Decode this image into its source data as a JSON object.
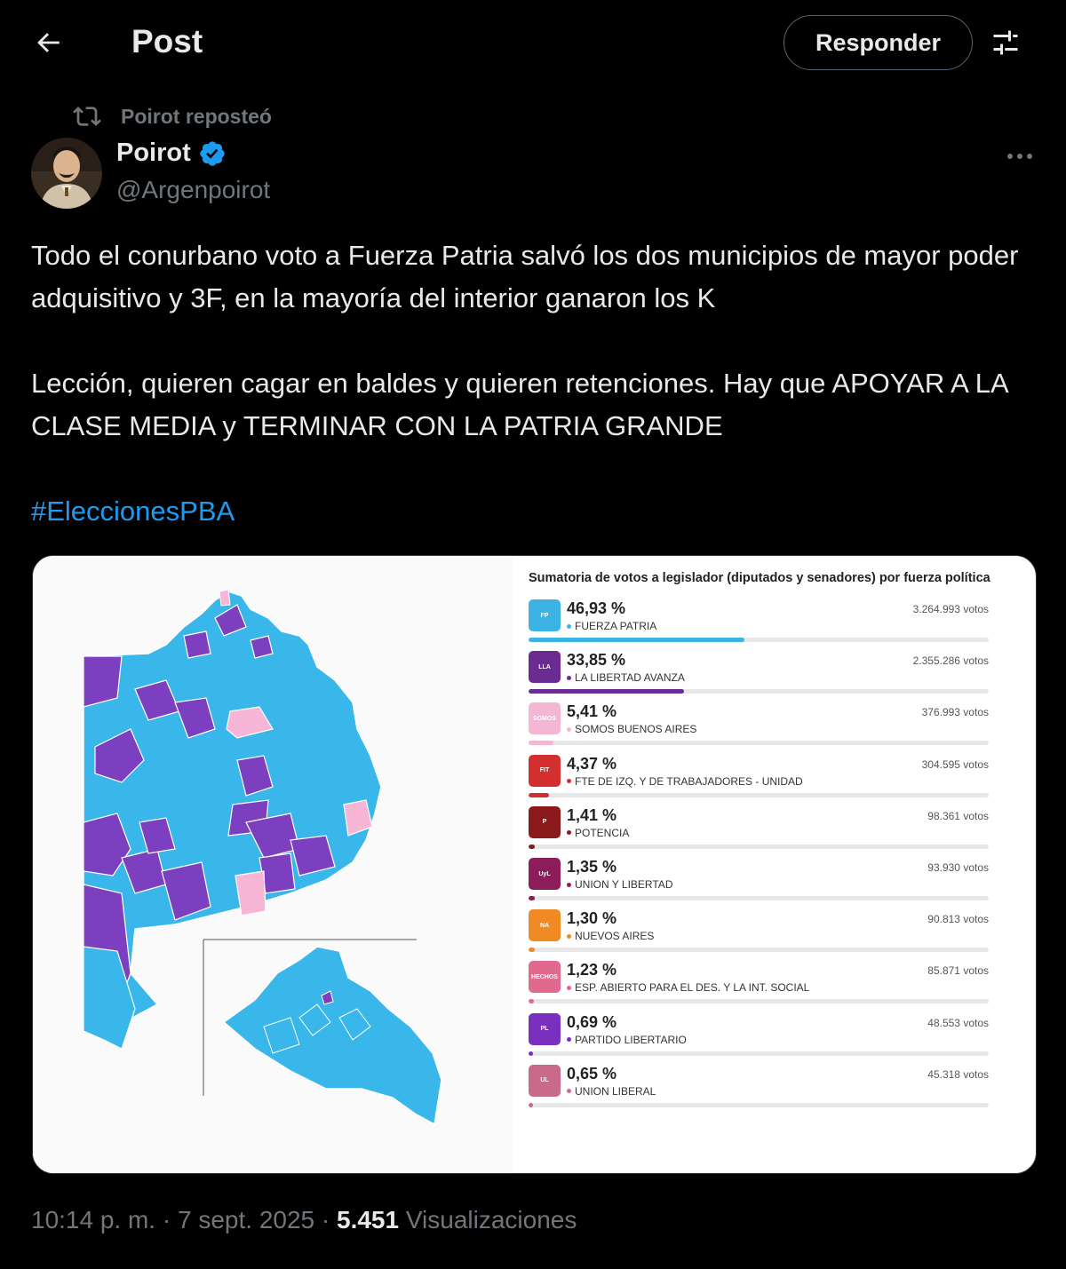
{
  "header": {
    "title": "Post",
    "reply_label": "Responder"
  },
  "repost": {
    "text": "Poirot reposteó"
  },
  "author": {
    "name": "Poirot",
    "handle": "@Argenpoirot"
  },
  "tweet": {
    "paragraph1": "Todo el conurbano voto a Fuerza Patria salvó los dos municipios de mayor poder adquisitivo y 3F, en la mayoría del interior ganaron los K",
    "paragraph2": "Lección, quieren cagar en baldes y quieren retenciones. Hay que APOYAR A LA CLASE MEDIA y TERMINAR CON LA PATRIA GRANDE",
    "hashtag": "#EleccionesPBA"
  },
  "chart_data": {
    "type": "bar",
    "title": "Sumatoria de votos a legislador (diputados y senadores) por fuerza política",
    "parties": [
      {
        "pct": "46,93 %",
        "name": "FUERZA PATRIA",
        "votes": "3.264.993 votos",
        "value": 46.93,
        "color": "#3bb4e5",
        "logo": "FP"
      },
      {
        "pct": "33,85 %",
        "name": "LA LIBERTAD AVANZA",
        "votes": "2.355.286 votos",
        "value": 33.85,
        "color": "#6a2c91",
        "logo": "LLA"
      },
      {
        "pct": "5,41 %",
        "name": "SOMOS BUENOS AIRES",
        "votes": "376.993 votos",
        "value": 5.41,
        "color": "#f4b6d2",
        "logo": "SOMOS"
      },
      {
        "pct": "4,37 %",
        "name": "FTE DE IZQ. Y DE TRABAJADORES - UNIDAD",
        "votes": "304.595 votos",
        "value": 4.37,
        "color": "#d32f2f",
        "logo": "FIT"
      },
      {
        "pct": "1,41 %",
        "name": "POTENCIA",
        "votes": "98.361 votos",
        "value": 1.41,
        "color": "#8b1a1a",
        "logo": "P"
      },
      {
        "pct": "1,35 %",
        "name": "UNION Y LIBERTAD",
        "votes": "93.930 votos",
        "value": 1.35,
        "color": "#8c1d5a",
        "logo": "UyL"
      },
      {
        "pct": "1,30 %",
        "name": "NUEVOS AIRES",
        "votes": "90.813 votos",
        "value": 1.3,
        "color": "#f08a24",
        "logo": "NA"
      },
      {
        "pct": "1,23 %",
        "name": "ESP. ABIERTO PARA EL DES. Y LA INT. SOCIAL",
        "votes": "85.871 votos",
        "value": 1.23,
        "color": "#e06a8e",
        "logo": "HECHOS"
      },
      {
        "pct": "0,69 %",
        "name": "PARTIDO LIBERTARIO",
        "votes": "48.553 votos",
        "value": 0.69,
        "color": "#7b2fbf",
        "logo": "PL"
      },
      {
        "pct": "0,65 %",
        "name": "UNION LIBERAL",
        "votes": "45.318 votos",
        "value": 0.65,
        "color": "#c96a8a",
        "logo": "UL"
      }
    ]
  },
  "meta": {
    "time": "10:14 p. m.",
    "sep1": " · ",
    "date": "7 sept. 2025",
    "sep2": " · ",
    "views_count": "5.451",
    "views_label": " Visualizaciones"
  },
  "colors": {
    "accent": "#1d9bf0",
    "background": "#000000",
    "muted": "#71767b",
    "verified": "#1d9bf0"
  }
}
